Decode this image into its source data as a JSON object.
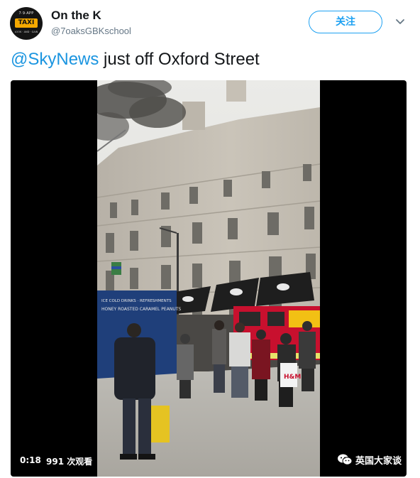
{
  "author": {
    "name": "On the K",
    "handle": "@7oaksGBKschool",
    "avatar": {
      "top_text": "7·9·APP",
      "badge_text": "TAXI",
      "bottom_text": "LOOK · AND · GAIN"
    }
  },
  "follow_label": "关注",
  "icons": {
    "menu": "chevron-down-icon",
    "watermark": "wechat-icon"
  },
  "tweet": {
    "mention": "@SkyNews",
    "text": " just off Oxford Street"
  },
  "video": {
    "timestamp": "0:18",
    "views": "991 次观看",
    "watermark": "英国大家谈",
    "sign_lines": [
      "ICE COLD DRINKS · REFRESHMENTS",
      "HONEY ROASTED CARAMEL PEANUTS"
    ],
    "shopping_bag_text": "H&M"
  },
  "colors": {
    "link": "#1b95e0",
    "follow": "#1da1f2",
    "handle": "#657786",
    "fire_engine": "#c8102e"
  }
}
